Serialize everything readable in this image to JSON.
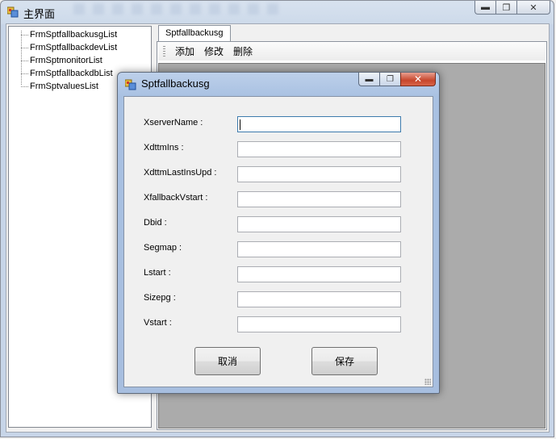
{
  "main": {
    "title": "主界面",
    "window_buttons": {
      "minimize": "▭",
      "maximize": "▢",
      "close": "✕"
    }
  },
  "tree": {
    "items": [
      {
        "label": "FrmSptfallbackusgList"
      },
      {
        "label": "FrmSptfallbackdevList"
      },
      {
        "label": "FrmSptmonitorList"
      },
      {
        "label": "FrmSptfallbackdbList"
      },
      {
        "label": "FrmSptvaluesList"
      }
    ]
  },
  "tabs": [
    {
      "label": "Sptfallbackusg"
    }
  ],
  "toolbar": {
    "add_label": "添加",
    "edit_label": "修改",
    "delete_label": "删除"
  },
  "dialog": {
    "title": "Sptfallbackusg",
    "fields": [
      {
        "label": "XserverName :",
        "value": ""
      },
      {
        "label": "XdttmIns :",
        "value": ""
      },
      {
        "label": "XdttmLastInsUpd :",
        "value": ""
      },
      {
        "label": "XfallbackVstart :",
        "value": ""
      },
      {
        "label": "Dbid :",
        "value": ""
      },
      {
        "label": "Segmap :",
        "value": ""
      },
      {
        "label": "Lstart :",
        "value": ""
      },
      {
        "label": "Sizepg :",
        "value": ""
      },
      {
        "label": "Vstart :",
        "value": ""
      }
    ],
    "cancel_label": "取消",
    "save_label": "保存"
  },
  "colors": {
    "accent": "#3d7bad",
    "close_red": "#c7462c",
    "grid_bg": "#ababab"
  },
  "icons": [
    "app-icon",
    "minimize-icon",
    "maximize-icon",
    "close-icon"
  ]
}
